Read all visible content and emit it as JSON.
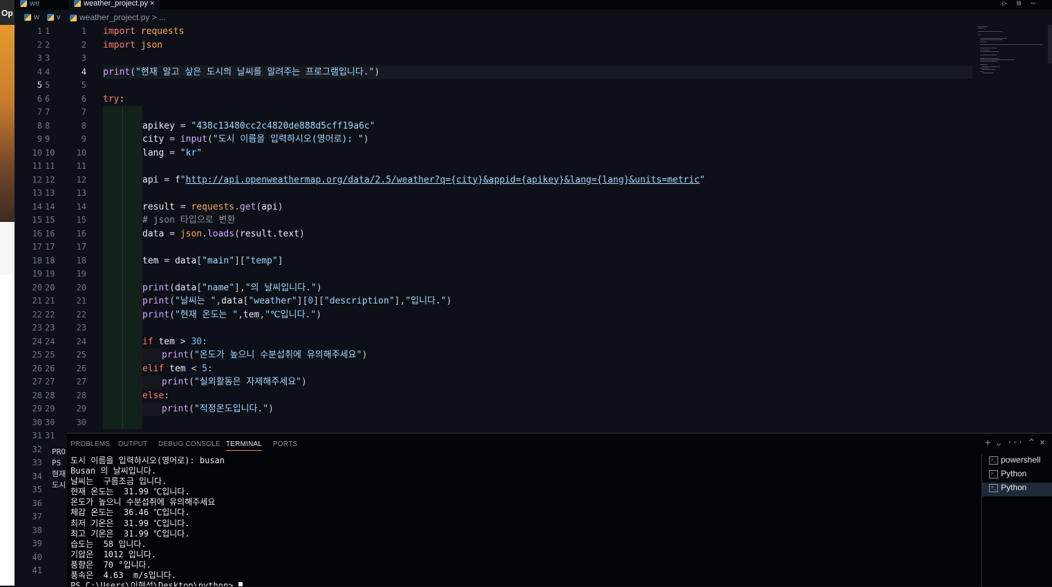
{
  "left_strip": {
    "label": "Op"
  },
  "tabs": {
    "back_tab_label": "we",
    "active_tab_label": "weather_project.py",
    "close_glyph": "×"
  },
  "breadcrumb": {
    "back_label": "w",
    "file": "weather_project.py",
    "sep": "> ...",
    "back2": "v"
  },
  "editor": {
    "active_line": 4,
    "back_active_line": 5,
    "code_lines": [
      "import requests",
      "import json",
      "",
      "print(\"현재 알고 싶은 도시의 날씨를 알려주는 프로그램입니다.\")",
      "",
      "try:",
      "",
      "    apikey = \"438c13480cc2c4820de888d5cff19a6c\"",
      "    city = input(\"도시 이름을 입력하시오(영어로): \")",
      "    lang = \"kr\"",
      "",
      "    api = f\"http://api.openweathermap.org/data/2.5/weather?q={city}&appid={apikey}&lang={lang}&units=metric\"",
      "",
      "    result = requests.get(api)",
      "    # json 타입으로 변환",
      "    data = json.loads(result.text)",
      "",
      "    tem = data[\"main\"][\"temp\"]",
      "",
      "    print(data[\"name\"],\"의 날씨입니다.\")",
      "    print(\"날씨는 \",data[\"weather\"][0][\"description\"],\"입니다.\")",
      "    print(\"현재 온도는 \",tem,\"℃입니다.\")",
      "",
      "    if tem > 30:",
      "        print(\"온도가 높으니 수분섭취에 유의해주세요\")",
      "    elif tem < 5:",
      "        print(\"실외활동은 자제해주세요\")",
      "    else:",
      "        print(\"적정온도입니다.\")",
      ""
    ]
  },
  "back_editor": {
    "line_count": 41
  },
  "back_terminal": {
    "lines": [
      "PRO",
      "PS",
      "현재",
      "도시"
    ]
  },
  "panel": {
    "tabs": [
      "PROBLEMS",
      "OUTPUT",
      "DEBUG CONSOLE",
      "TERMINAL",
      "PORTS"
    ],
    "active_tab": "TERMINAL",
    "actions": [
      "+",
      "⌄",
      "···",
      "^",
      "×"
    ],
    "terminal_lines": [
      "도시 이름을 입력하시오(영어로): busan",
      "Busan 의 날씨입니다.",
      "날씨는  구름조금 입니다.",
      "현재 온도는  31.99 ℃입니다.",
      "온도가 높으니 수분섭취에 유의해주세요",
      "체감 온도는  36.46 ℃입니다.",
      "최저 기온은  31.99 ℃입니다.",
      "최고 기온은  31.99 ℃입니다.",
      "습도는  58 입니다.",
      "기압은  1012 입니다.",
      "풍향은  70 °입니다.",
      "풍속은  4.63  m/s입니다.",
      "PS C:\\Users\\이형석\\Desktop\\python> "
    ],
    "terminals": [
      {
        "name": "powershell",
        "active": false
      },
      {
        "name": "Python",
        "active": false
      },
      {
        "name": "Python",
        "active": true
      }
    ]
  }
}
